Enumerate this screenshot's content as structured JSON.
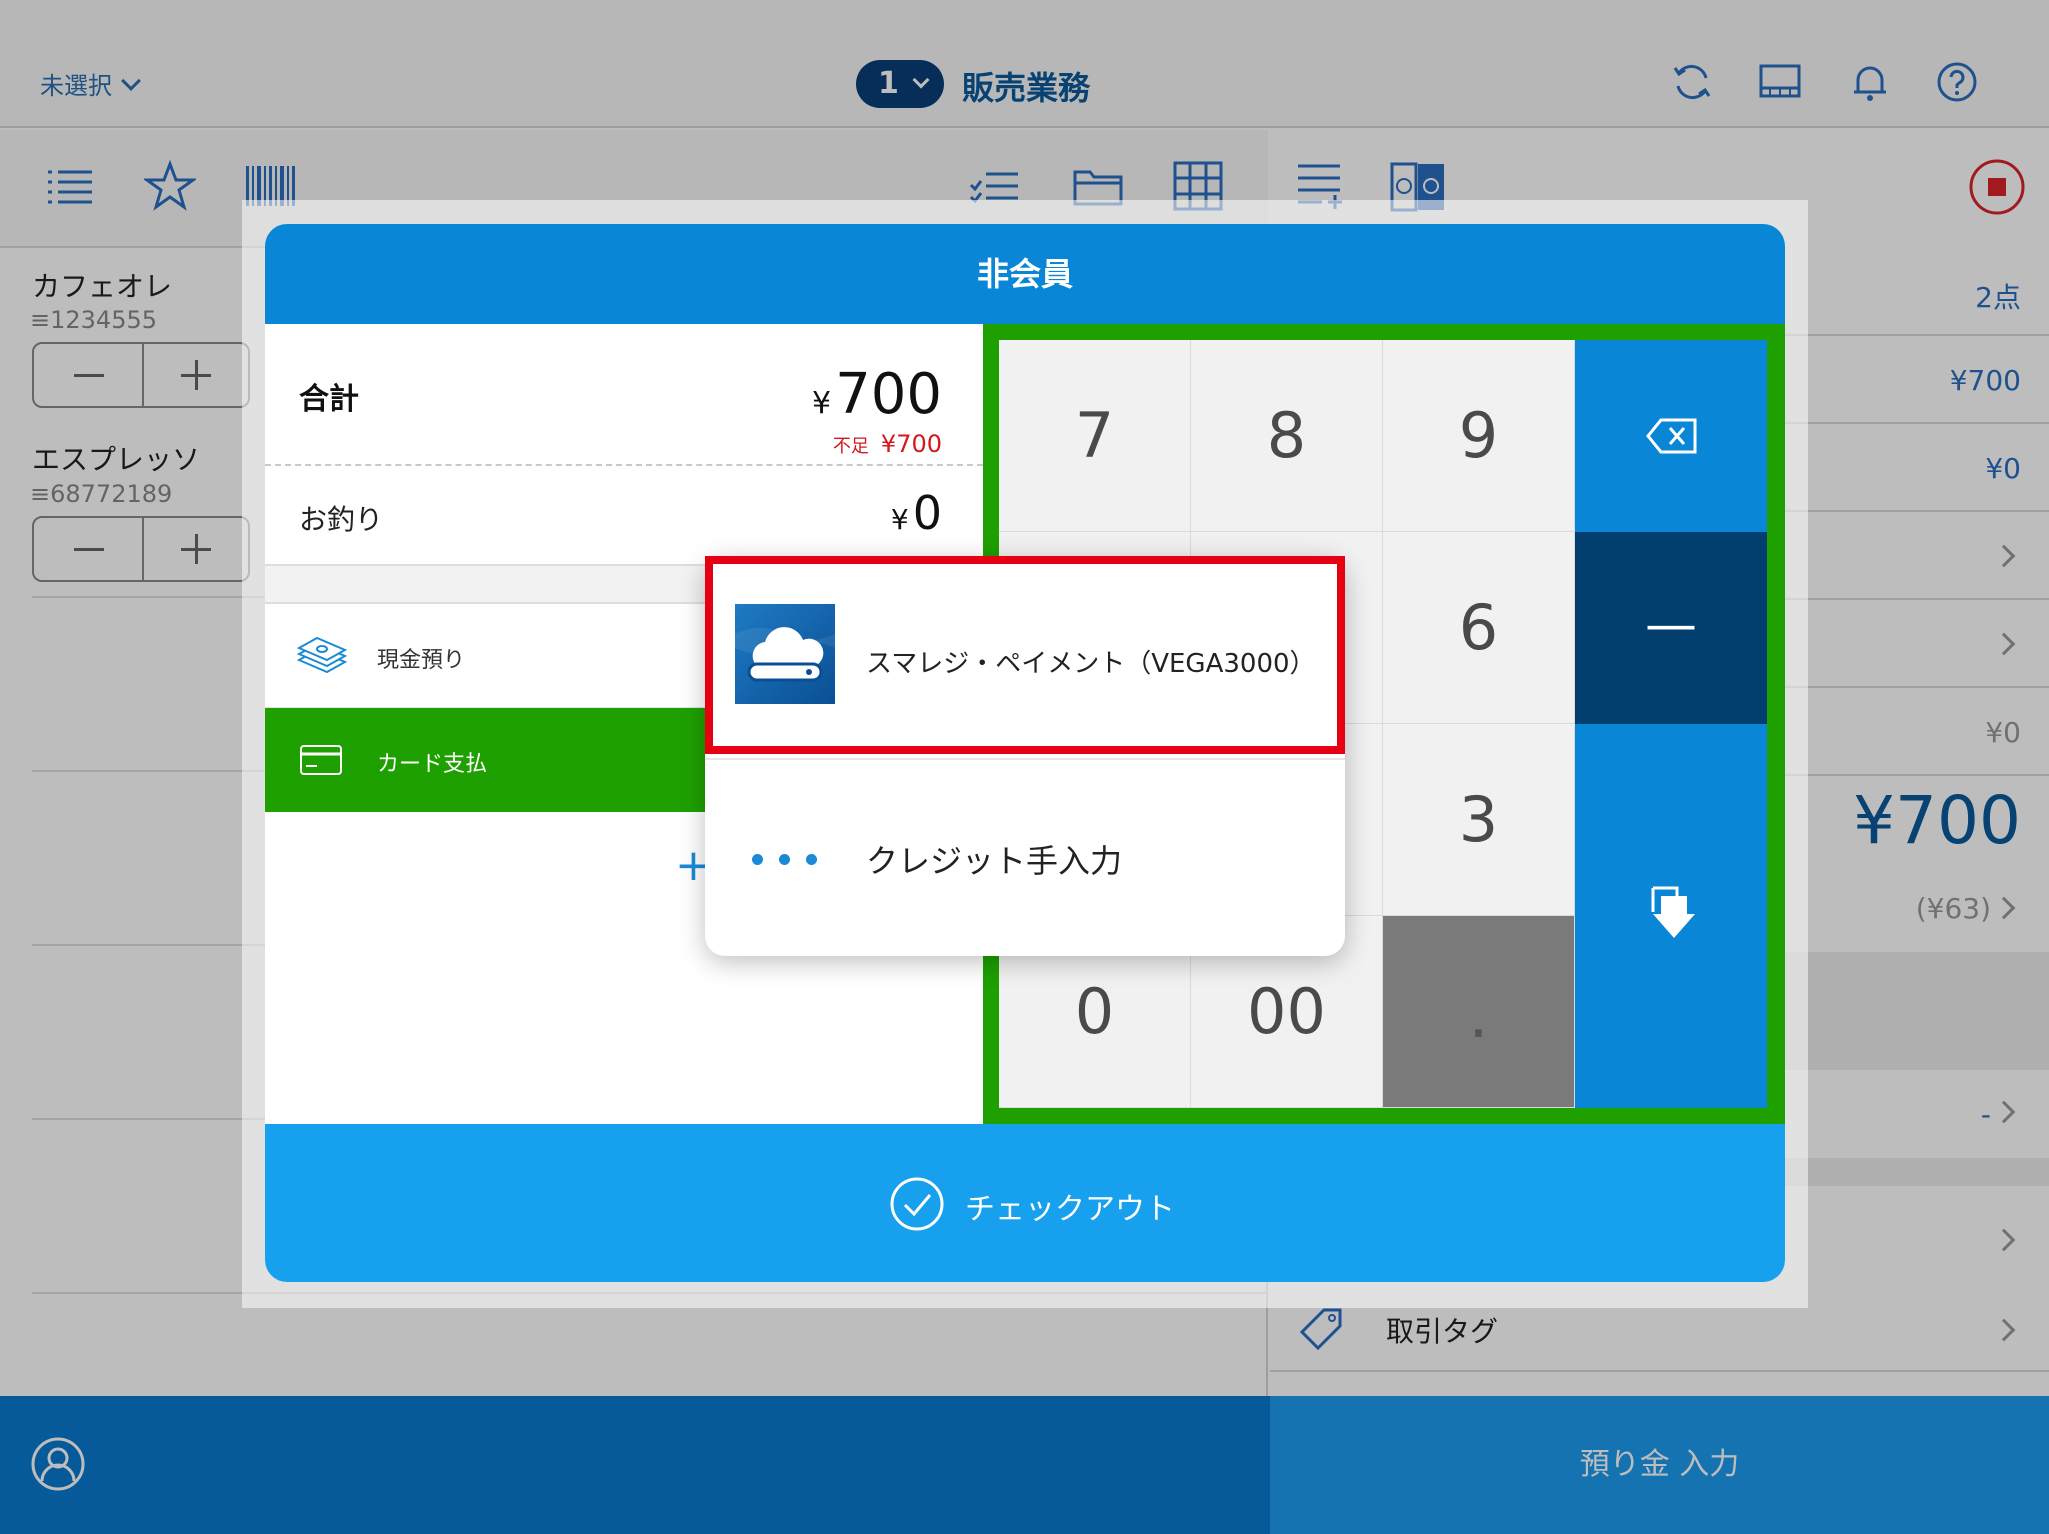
{
  "topbar": {
    "store_select": "未選択",
    "register_number": "1",
    "mode_title": "販売業務"
  },
  "products": [
    {
      "name": "カフェオレ",
      "code": "1234555"
    },
    {
      "name": "エスプレッソ",
      "code": "68772189"
    }
  ],
  "summary": {
    "item_count": "2点",
    "subtotal": "¥700",
    "discount": "¥0",
    "other": "¥0",
    "total": "¥700",
    "tax": "(¥63)",
    "tax_dash": "-",
    "tag_label": "取引タグ"
  },
  "bottom": {
    "deposit_button": "預り金 入力"
  },
  "modal": {
    "title": "非会員",
    "total_label": "合計",
    "total_yen": "¥",
    "total_value": "700",
    "short_label": "不足",
    "short_value": "¥700",
    "change_label": "お釣り",
    "change_yen": "¥",
    "change_value": "0",
    "payments": [
      {
        "label": "現金預り"
      },
      {
        "label": "カード支払"
      }
    ],
    "add_symbol": "+",
    "keypad": {
      "k7": "7",
      "k8": "8",
      "k9": "9",
      "k6": "6",
      "k3": "3",
      "k0": "0",
      "k00": "00",
      "kdot": ".",
      "kminus": "—"
    },
    "checkout_label": "チェックアウト"
  },
  "popover": {
    "options": [
      {
        "label": "スマレジ・ペイメント（VEGA3000）"
      },
      {
        "label": "クレジット手入力"
      }
    ]
  },
  "colors": {
    "accent_blue": "#0a86d6",
    "selected_green": "#1ea000",
    "highlight_red": "#e60012"
  }
}
